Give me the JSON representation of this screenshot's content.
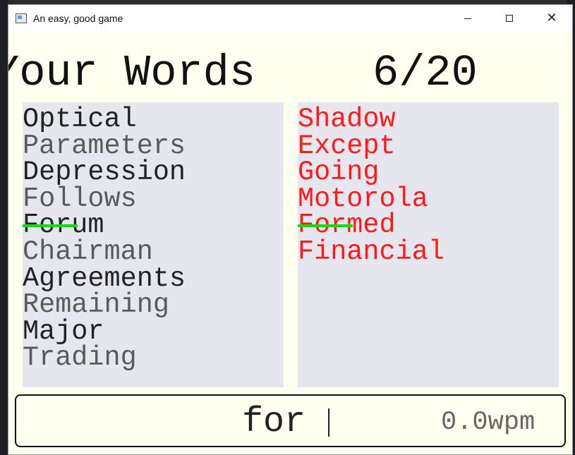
{
  "window": {
    "title": "An easy, good game"
  },
  "header": {
    "heading": "Your Words",
    "count": "6/20"
  },
  "left_words": [
    {
      "text": "Optical",
      "typed": "",
      "rest": "Optical"
    },
    {
      "text": "Parameters",
      "typed": "",
      "rest": "Parameters"
    },
    {
      "text": "Depression",
      "typed": "",
      "rest": "Depression"
    },
    {
      "text": "Follows",
      "typed": "",
      "rest": "Follows"
    },
    {
      "text": "Forum",
      "typed": "For",
      "rest": "um"
    },
    {
      "text": "Chairman",
      "typed": "",
      "rest": "Chairman"
    },
    {
      "text": "Agreements",
      "typed": "",
      "rest": "Agreements"
    },
    {
      "text": "Remaining",
      "typed": "",
      "rest": "Remaining"
    },
    {
      "text": "Major",
      "typed": "",
      "rest": "Major"
    },
    {
      "text": "Trading",
      "typed": "",
      "rest": "Trading"
    }
  ],
  "right_words": [
    {
      "text": "Shadow",
      "typed": "",
      "rest": "Shadow"
    },
    {
      "text": "Except",
      "typed": "",
      "rest": "Except"
    },
    {
      "text": "Going",
      "typed": "",
      "rest": "Going"
    },
    {
      "text": "Motorola",
      "typed": "",
      "rest": "Motorola"
    },
    {
      "text": "Formed",
      "typed": "For",
      "rest": "med"
    },
    {
      "text": "Financial",
      "typed": "",
      "rest": "Financial"
    }
  ],
  "input": {
    "typed_text": "for",
    "wpm": "0.0wpm"
  },
  "colors": {
    "window_bg": "#fffff0",
    "panel_bg": "#e6e6ee",
    "player_words": "#222222",
    "opponent_words": "#ff1a1a",
    "match_highlight": "#00e600"
  }
}
